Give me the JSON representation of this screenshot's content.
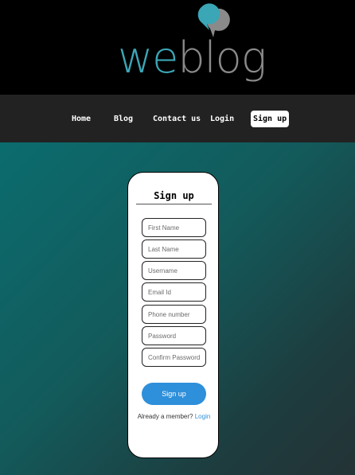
{
  "logo": {
    "text_we": "we",
    "text_blog": "blog",
    "we_color": "#3ba6b5",
    "blog_color": "#8a8a8a",
    "bubble_front_color": "#3ba6b5",
    "bubble_back_color": "#8a8a8a"
  },
  "nav": {
    "items": [
      {
        "label": "Home"
      },
      {
        "label": "Blog"
      },
      {
        "label": "Contact us"
      },
      {
        "label": "Login"
      },
      {
        "label": "Sign up",
        "active": true
      }
    ]
  },
  "form": {
    "title": "Sign up",
    "fields": [
      {
        "placeholder": "First Name",
        "value": ""
      },
      {
        "placeholder": "Last Name",
        "value": ""
      },
      {
        "placeholder": "Username",
        "value": ""
      },
      {
        "placeholder": "Email Id",
        "value": ""
      },
      {
        "placeholder": "Phone number",
        "value": ""
      },
      {
        "placeholder": "Password",
        "value": ""
      },
      {
        "placeholder": "Confirm Password",
        "value": ""
      }
    ],
    "submit_label": "Sign up",
    "member_text": "Already a member?",
    "login_link": "Login",
    "button_color": "#2e8fda"
  }
}
